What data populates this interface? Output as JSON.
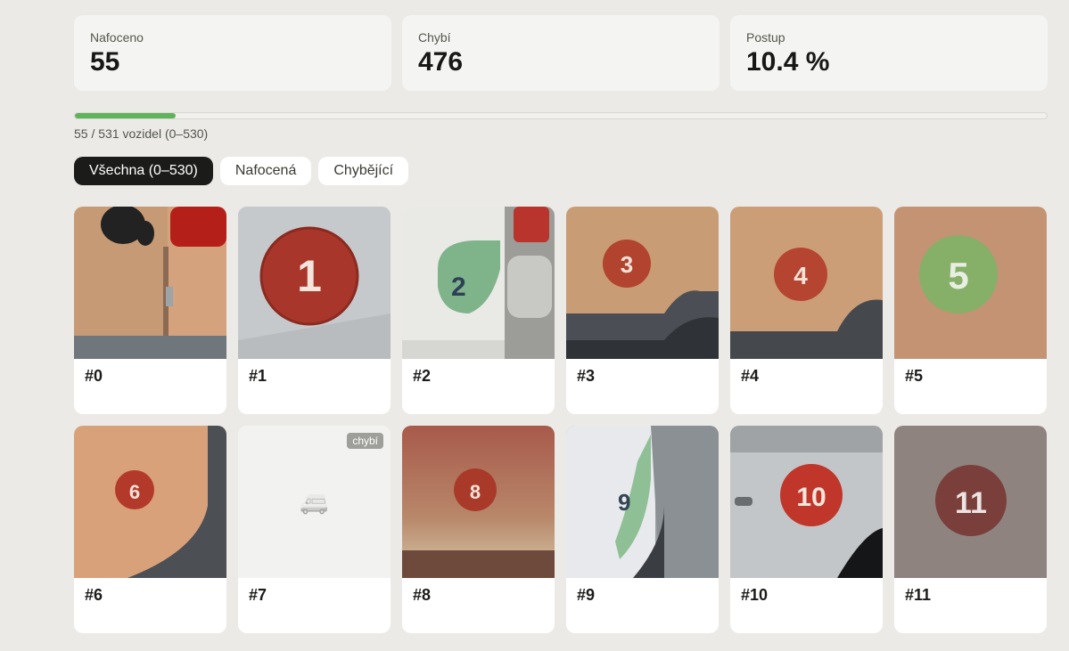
{
  "stats": [
    {
      "label": "Nafoceno",
      "value": "55"
    },
    {
      "label": "Chybí",
      "value": "476"
    },
    {
      "label": "Postup",
      "value": "10.4 %"
    }
  ],
  "progress": {
    "fraction": 0.104,
    "text": "55 / 531 vozidel (0–530)"
  },
  "filters": [
    {
      "label": "Všechna (0–530)",
      "active": true
    },
    {
      "label": "Nafocená",
      "active": false
    },
    {
      "label": "Chybějící",
      "active": false
    }
  ],
  "colors": {
    "progress": "#5fb35a",
    "active_filter": "#1b1b1a",
    "sticker_red": "#b23a2a",
    "sticker_green": "#7cb66a"
  },
  "cards": [
    {
      "label": "#0",
      "photo": true
    },
    {
      "label": "#1",
      "photo": true,
      "sticker": "1"
    },
    {
      "label": "#2",
      "photo": true,
      "sticker": "2"
    },
    {
      "label": "#3",
      "photo": true,
      "sticker": "3"
    },
    {
      "label": "#4",
      "photo": true,
      "sticker": "4"
    },
    {
      "label": "#5",
      "photo": true,
      "sticker": "5"
    },
    {
      "label": "#6",
      "photo": true,
      "sticker": "6"
    },
    {
      "label": "#7",
      "photo": false,
      "badge": "chybí",
      "icon": "van-icon"
    },
    {
      "label": "#8",
      "photo": true,
      "sticker": "8"
    },
    {
      "label": "#9",
      "photo": true,
      "sticker": "9"
    },
    {
      "label": "#10",
      "photo": true,
      "sticker": "10"
    },
    {
      "label": "#11",
      "photo": true,
      "sticker": "11"
    }
  ]
}
